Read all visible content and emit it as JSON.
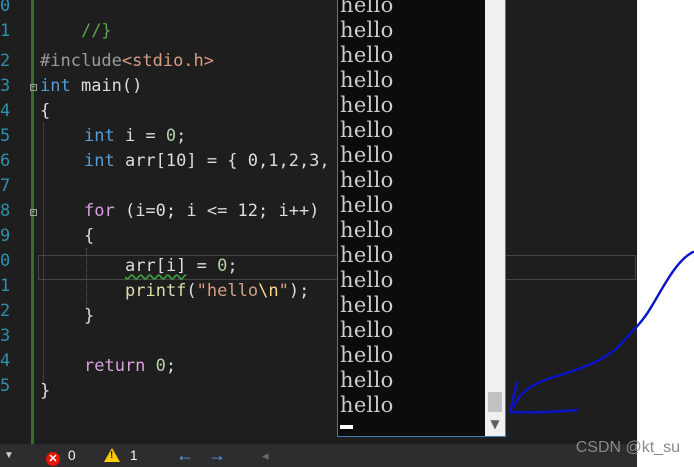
{
  "editor": {
    "line_numbers": [
      "0",
      "1",
      "2",
      "3",
      "4",
      "5",
      "6",
      "7",
      "8",
      "9",
      "0",
      "1",
      "2",
      "3",
      "4",
      "5"
    ],
    "code": {
      "l0_comment": "//}",
      "l2_pre": "#include",
      "l2_inc": "<stdio.h>",
      "l3_type": "int",
      "l3_name": " main()",
      "l4": "{",
      "l5_type": "int",
      "l5_rest": " i = ",
      "l5_num": "0",
      "l5_end": ";",
      "l6_type": "int",
      "l6_rest": " arr[10] = { 0,1,2,3,",
      "l8_kw": "for",
      "l8_rest": " (i=0; i <= 12; i++)",
      "l9": "{",
      "l10_var": "arr[i]",
      "l10_rest": " = ",
      "l10_num": "0",
      "l10_end": ";",
      "l11_fn": "printf",
      "l11_open": "(",
      "l11_str": "\"hello",
      "l11_esc": "\\n",
      "l11_strend": "\"",
      "l11_end": ");",
      "l12": "}",
      "l14_kw": "return",
      "l14_num": " 0",
      "l14_end": ";",
      "l15": "}"
    }
  },
  "console": {
    "output_lines": [
      "hello",
      "hello",
      "hello",
      "hello",
      "hello",
      "hello",
      "hello",
      "hello",
      "hello",
      "hello",
      "hello",
      "hello",
      "hello",
      "hello",
      "hello",
      "hello",
      "hello"
    ]
  },
  "status_bar": {
    "errors_count": "0",
    "warnings_count": "1",
    "back_arrow": "←",
    "forward_arrow": "→",
    "left_caret": "◂",
    "scroll_left": "◂"
  },
  "watermark": "CSDN @kt_su",
  "colors": {
    "editor_bg": "#1e1e1e",
    "console_bg": "#0c0c0c",
    "annotation_ink": "#0a14c8"
  }
}
